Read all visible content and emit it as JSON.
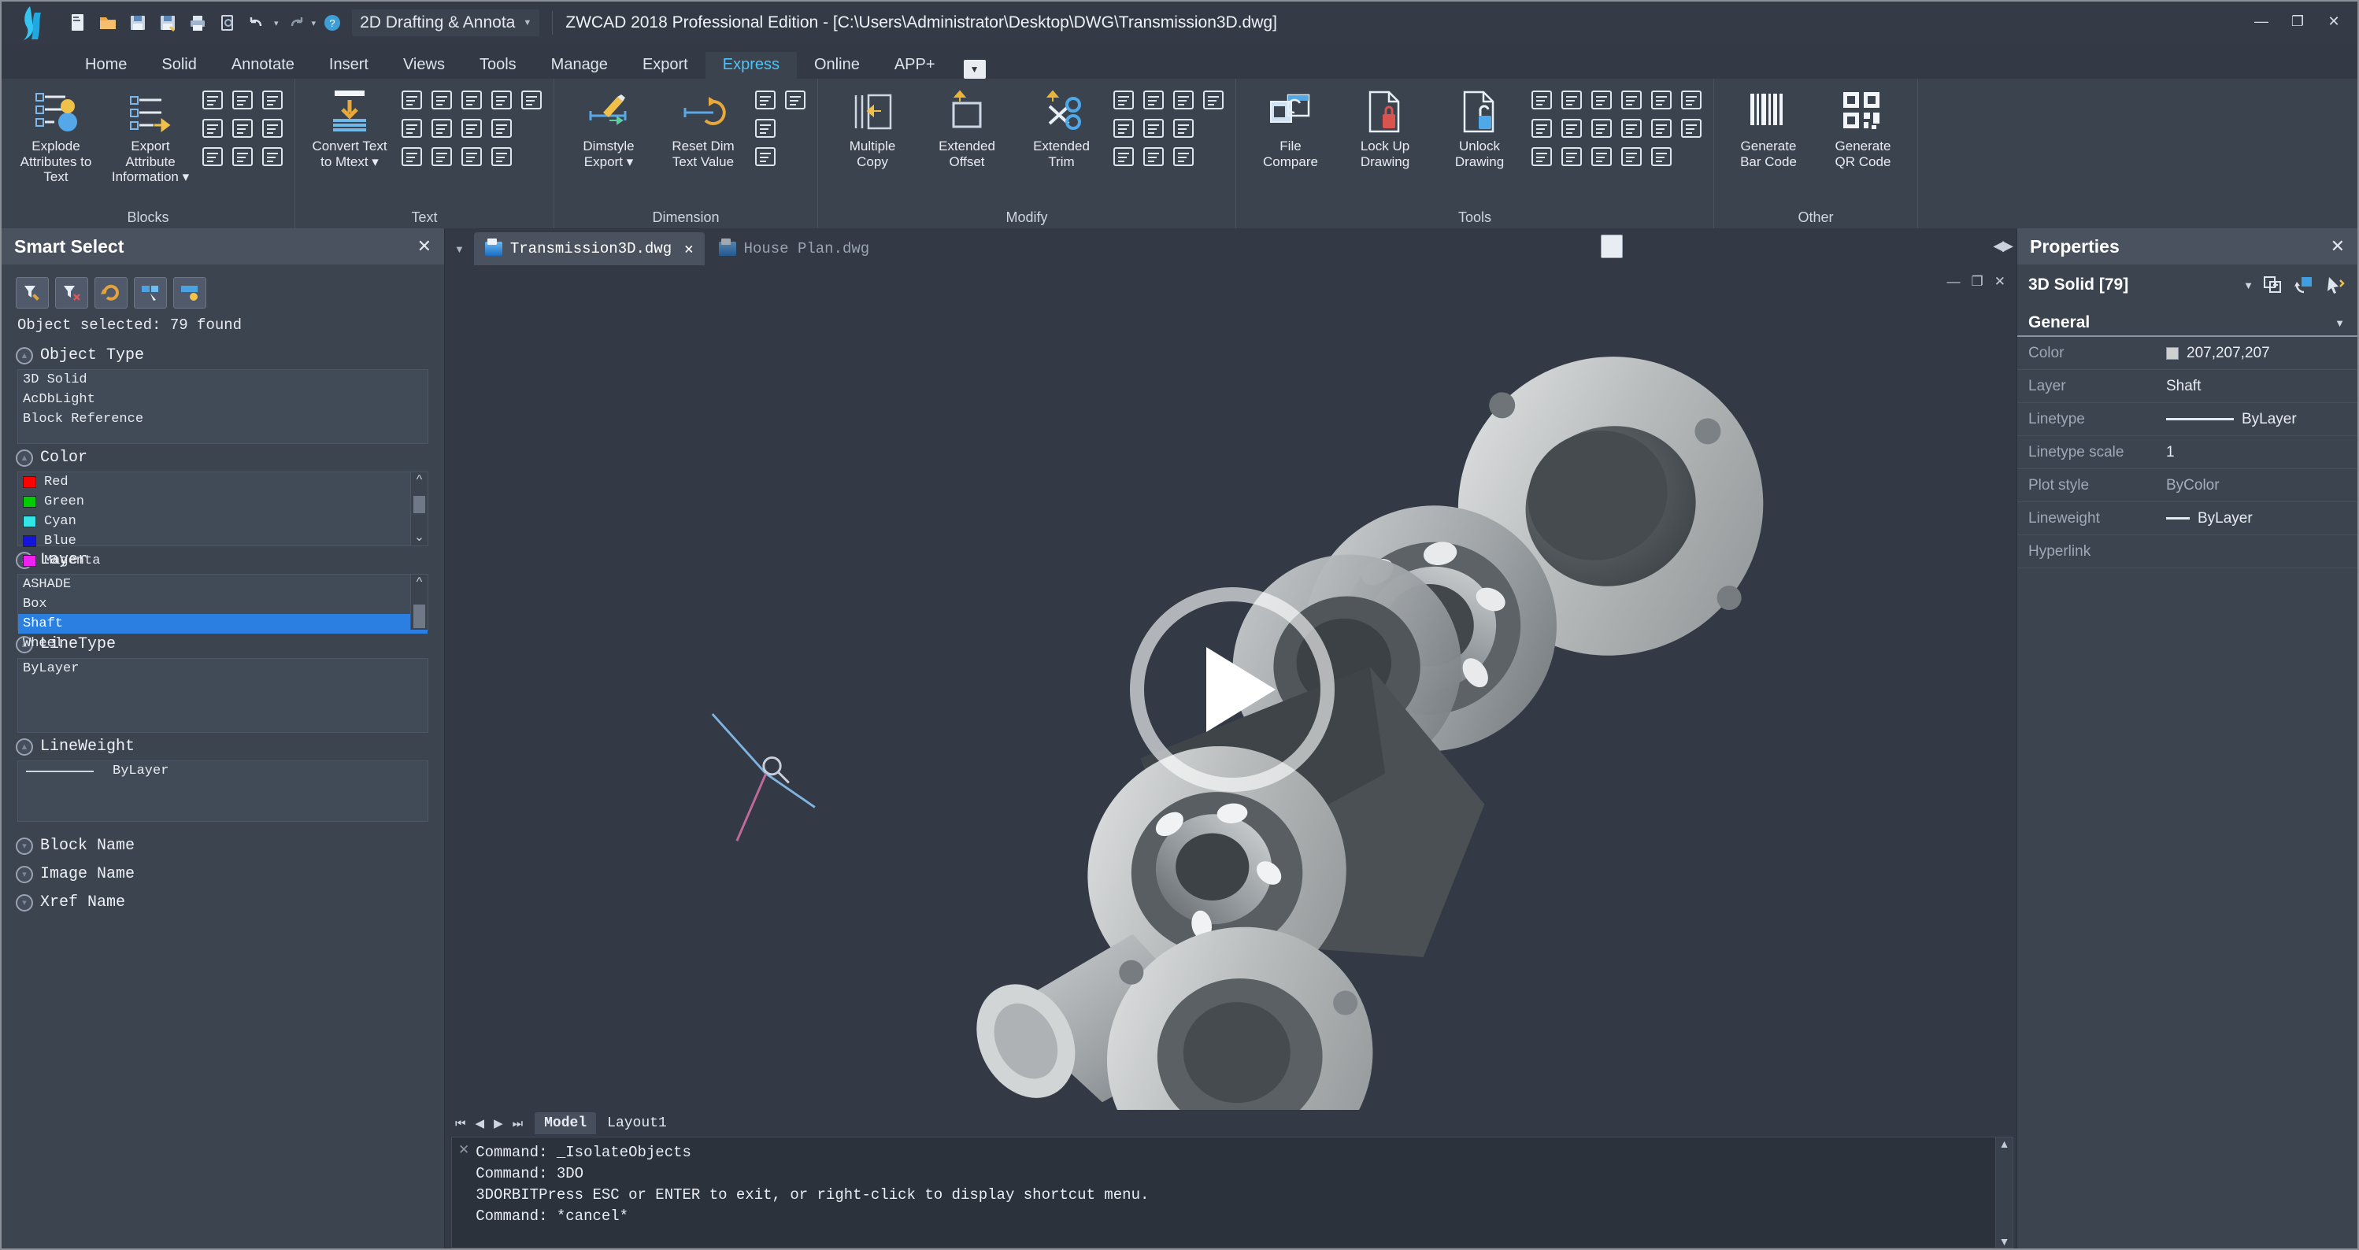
{
  "titlebar": {
    "workspace": "2D Drafting & Annota",
    "app_title": "ZWCAD 2018 Professional Edition - [C:\\Users\\Administrator\\Desktop\\DWG\\Transmission3D.dwg]",
    "quick_access": [
      {
        "name": "new-file-icon",
        "label": "New"
      },
      {
        "name": "open-folder-icon",
        "label": "Open"
      },
      {
        "name": "save-icon",
        "label": "Save"
      },
      {
        "name": "save-as-icon",
        "label": "Save As"
      },
      {
        "name": "print-icon",
        "label": "Print"
      },
      {
        "name": "print-preview-icon",
        "label": "Print Preview"
      },
      {
        "name": "undo-icon",
        "label": "Undo"
      },
      {
        "name": "redo-icon",
        "label": "Redo"
      },
      {
        "name": "help-icon",
        "label": "Help"
      }
    ],
    "window_controls": {
      "minimize": "—",
      "maximize": "❐",
      "close": "✕"
    }
  },
  "ribbon_tabs": [
    {
      "label": "Home",
      "active": false
    },
    {
      "label": "Solid",
      "active": false
    },
    {
      "label": "Annotate",
      "active": false
    },
    {
      "label": "Insert",
      "active": false
    },
    {
      "label": "Views",
      "active": false
    },
    {
      "label": "Tools",
      "active": false
    },
    {
      "label": "Manage",
      "active": false
    },
    {
      "label": "Export",
      "active": false
    },
    {
      "label": "Express",
      "active": true
    },
    {
      "label": "Online",
      "active": false
    },
    {
      "label": "APP+",
      "active": false
    }
  ],
  "ribbon_panels": [
    {
      "title": "Blocks",
      "big_buttons": [
        {
          "label": "Explode\nAttributes to Text",
          "icon": "explode-attributes-icon"
        },
        {
          "label": "Export Attribute\nInformation ▾",
          "icon": "export-attribute-icon"
        }
      ],
      "small_buttons": [
        "block-scale-icon",
        "block-replace-icon",
        "block-list-icon",
        "attribute-edit-icon",
        "block-nested-icon",
        "block-copy-icon",
        "block-table-icon",
        "block-explode-icon",
        "block-convert-icon"
      ]
    },
    {
      "title": "Text",
      "big_buttons": [
        {
          "label": "Convert Text\nto Mtext ▾",
          "icon": "convert-text-mtext-icon"
        }
      ],
      "small_buttons": [
        "text-frame-icon",
        "text-list-icon",
        "text-align-arc-icon",
        "text-abc-icon",
        "text-arc-abc-icon",
        "text-fit-icon",
        "text-mask-icon",
        "text-rotate-icon",
        "text-explode-icon",
        "text-single-icon",
        "text-enclose-icon",
        "text-justify-icon",
        "text-incr-icon"
      ]
    },
    {
      "title": "Dimension",
      "big_buttons": [
        {
          "label": "Dimstyle\nExport ▾",
          "icon": "dimstyle-export-icon"
        },
        {
          "label": "Reset Dim\nText Value",
          "icon": "reset-dim-text-icon"
        }
      ],
      "small_buttons": [
        "dim-leader-icon",
        "dim-arrow-icon",
        "dim-break-icon",
        "dim-oblique-icon"
      ]
    },
    {
      "title": "Modify",
      "big_buttons": [
        {
          "label": "Multiple\nCopy",
          "icon": "multiple-copy-icon"
        },
        {
          "label": "Extended\nOffset",
          "icon": "extended-offset-icon"
        },
        {
          "label": "Extended\nTrim",
          "icon": "extended-trim-icon"
        }
      ],
      "small_buttons": [
        "flatten-icon",
        "extend-to-icon",
        "move-copy-icon",
        "align-list-icon",
        "break-line-icon",
        "spline-icon",
        "region-icon",
        "revcloud-icon",
        "rect-crop-icon",
        "polyline-edit-icon"
      ]
    },
    {
      "title": "Tools",
      "big_buttons": [
        {
          "label": "File\nCompare",
          "icon": "file-compare-icon"
        },
        {
          "label": "Lock Up\nDrawing",
          "icon": "lock-up-drawing-icon"
        },
        {
          "label": "Unlock\nDrawing",
          "icon": "unlock-drawing-icon"
        }
      ],
      "small_buttons": [
        "measure-tool-icon",
        "list-info-icon",
        "duplicate-icon",
        "super-purge-icon",
        "zoom-ext-icon",
        "image-tool-icon",
        "arc-align-icon",
        "erase-tool-icon",
        "coordinate-icon",
        "layer-tool-icon",
        "break-cross-icon",
        "lock-layer-icon",
        "node-tool-icon",
        "batch-list-icon",
        "image-clip-icon",
        "copy-nested-icon",
        "delete-dup-icon"
      ]
    },
    {
      "title": "Other",
      "big_buttons": [
        {
          "label": "Generate\nBar Code",
          "icon": "generate-barcode-icon"
        },
        {
          "label": "Generate\nQR Code",
          "icon": "generate-qrcode-icon"
        }
      ],
      "small_buttons": []
    }
  ],
  "smart_select": {
    "title": "Smart Select",
    "close_label": "✕",
    "toolbar": [
      {
        "name": "select-filter-icon"
      },
      {
        "name": "remove-filter-icon"
      },
      {
        "name": "invert-selection-icon"
      },
      {
        "name": "select-all-icon"
      },
      {
        "name": "select-settings-icon"
      }
    ],
    "status": "Object selected: 79 found",
    "sections": [
      {
        "id": "object-type",
        "label": "Object Type",
        "items": [
          {
            "text": "3D Solid"
          },
          {
            "text": "AcDbLight"
          },
          {
            "text": "Block Reference"
          }
        ]
      },
      {
        "id": "color",
        "label": "Color",
        "items": [
          {
            "text": "Red",
            "swatch": "#ff0000"
          },
          {
            "text": "Green",
            "swatch": "#00cc00"
          },
          {
            "text": "Cyan",
            "swatch": "#33e6e6"
          },
          {
            "text": "Blue",
            "swatch": "#1414dd"
          },
          {
            "text": "Magenta",
            "swatch": "#ee22ee"
          }
        ],
        "scroll": true
      },
      {
        "id": "layer",
        "label": "Layer",
        "items": [
          {
            "text": "ASHADE"
          },
          {
            "text": "Box"
          },
          {
            "text": "Shaft",
            "selected": true
          },
          {
            "text": "Wheel"
          }
        ],
        "scroll": true
      },
      {
        "id": "linetype",
        "label": "LineType",
        "items": [
          {
            "text": "ByLayer"
          }
        ]
      },
      {
        "id": "lineweight",
        "label": "LineWeight",
        "items": [
          {
            "text": "ByLayer",
            "line": true
          }
        ]
      }
    ],
    "radio_options": [
      {
        "label": "Block Name"
      },
      {
        "label": "Image Name"
      },
      {
        "label": "Xref Name"
      }
    ]
  },
  "document_tabs": [
    {
      "label": "Transmission3D.dwg",
      "active": true,
      "closable": true
    },
    {
      "label": "House Plan.dwg",
      "active": false,
      "closable": false
    }
  ],
  "viewport": {
    "controls": {
      "minimize": "—",
      "restore": "❐",
      "close": "✕"
    },
    "play_button": "play-overlay",
    "ucs_icon": "ucs-axis-icon"
  },
  "layout_tabs": {
    "nav": [
      "⏮",
      "◀",
      "▶",
      "⏭"
    ],
    "tabs": [
      {
        "label": "Model",
        "active": true
      },
      {
        "label": "Layout1",
        "active": false
      }
    ]
  },
  "command_line": {
    "close_label": "✕",
    "lines": [
      "Command: _IsolateObjects",
      "Command: 3DO",
      "3DORBITPress ESC or ENTER to exit, or right-click to display shortcut menu.",
      "Command: *cancel*"
    ]
  },
  "properties": {
    "title": "Properties",
    "close_label": "✕",
    "object": "3D Solid [79]",
    "toolbar": [
      {
        "name": "quick-select-icon"
      },
      {
        "name": "pickadd-icon"
      },
      {
        "name": "select-objects-icon"
      }
    ],
    "section": "General",
    "rows": [
      {
        "key": "Color",
        "value": "207,207,207",
        "swatch": "#cfcfcf"
      },
      {
        "key": "Layer",
        "value": "Shaft"
      },
      {
        "key": "Linetype",
        "value": "ByLayer",
        "line": "long"
      },
      {
        "key": "Linetype scale",
        "value": "1"
      },
      {
        "key": "Plot style",
        "value": "ByColor",
        "muted": true
      },
      {
        "key": "Lineweight",
        "value": "ByLayer",
        "line": "short"
      },
      {
        "key": "Hyperlink",
        "value": ""
      }
    ]
  },
  "colors": {
    "accent": "#4fc3f7",
    "selection": "#2b7fe0",
    "panel_bg": "#3c4450",
    "ribbon_bg": "#3b434f",
    "viewport_bg": "#333a45",
    "command_bg": "#2c323c"
  }
}
